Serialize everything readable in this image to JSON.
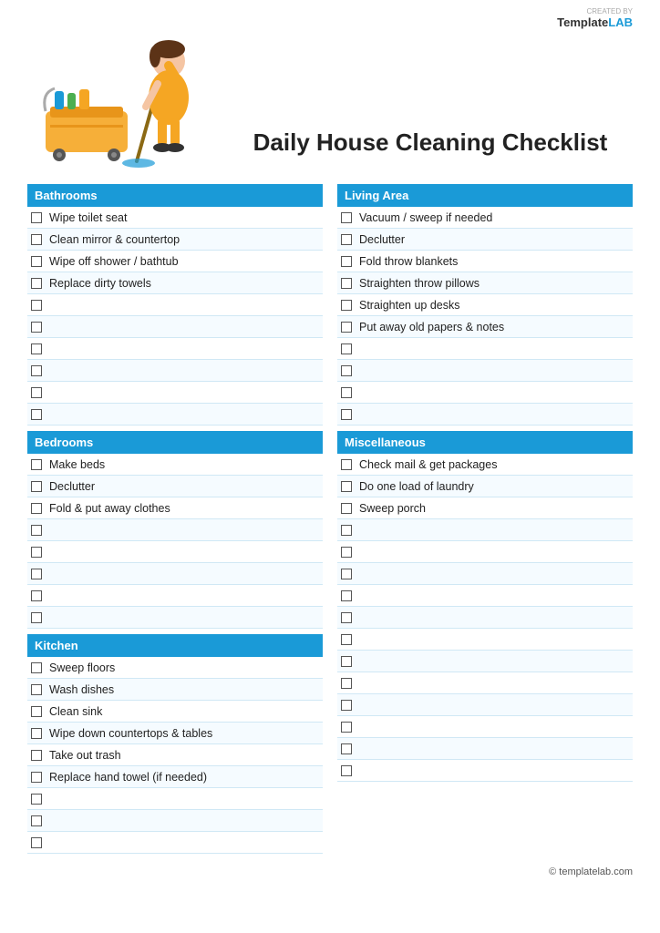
{
  "logo": {
    "created_by": "CREATED BY",
    "brand_template": "Template",
    "brand_lab": "LAB"
  },
  "title": "Daily House Cleaning Checklist",
  "sections": {
    "left": [
      {
        "id": "bathrooms",
        "label": "Bathrooms",
        "items": [
          "Wipe toilet seat",
          "Clean mirror & countertop",
          "Wipe off shower / bathtub",
          "Replace dirty towels",
          "",
          "",
          "",
          "",
          "",
          ""
        ]
      },
      {
        "id": "bedrooms",
        "label": "Bedrooms",
        "items": [
          "Make beds",
          "Declutter",
          "Fold & put away clothes",
          "",
          "",
          "",
          "",
          ""
        ]
      },
      {
        "id": "kitchen",
        "label": "Kitchen",
        "items": [
          "Sweep floors",
          "Wash dishes",
          "Clean sink",
          "Wipe down countertops & tables",
          "Take out trash",
          "Replace hand towel (if needed)",
          "",
          "",
          ""
        ]
      }
    ],
    "right": [
      {
        "id": "living-area",
        "label": "Living Area",
        "items": [
          "Vacuum / sweep if needed",
          "Declutter",
          "Fold throw blankets",
          "Straighten throw pillows",
          "Straighten up desks",
          "Put away old papers & notes",
          "",
          "",
          "",
          ""
        ]
      },
      {
        "id": "miscellaneous",
        "label": "Miscellaneous",
        "items": [
          "Check mail & get packages",
          "Do one load of laundry",
          "Sweep porch",
          "",
          "",
          "",
          "",
          "",
          "",
          "",
          "",
          "",
          "",
          "",
          ""
        ]
      }
    ]
  },
  "footer": {
    "text": "© templatelab.com"
  }
}
